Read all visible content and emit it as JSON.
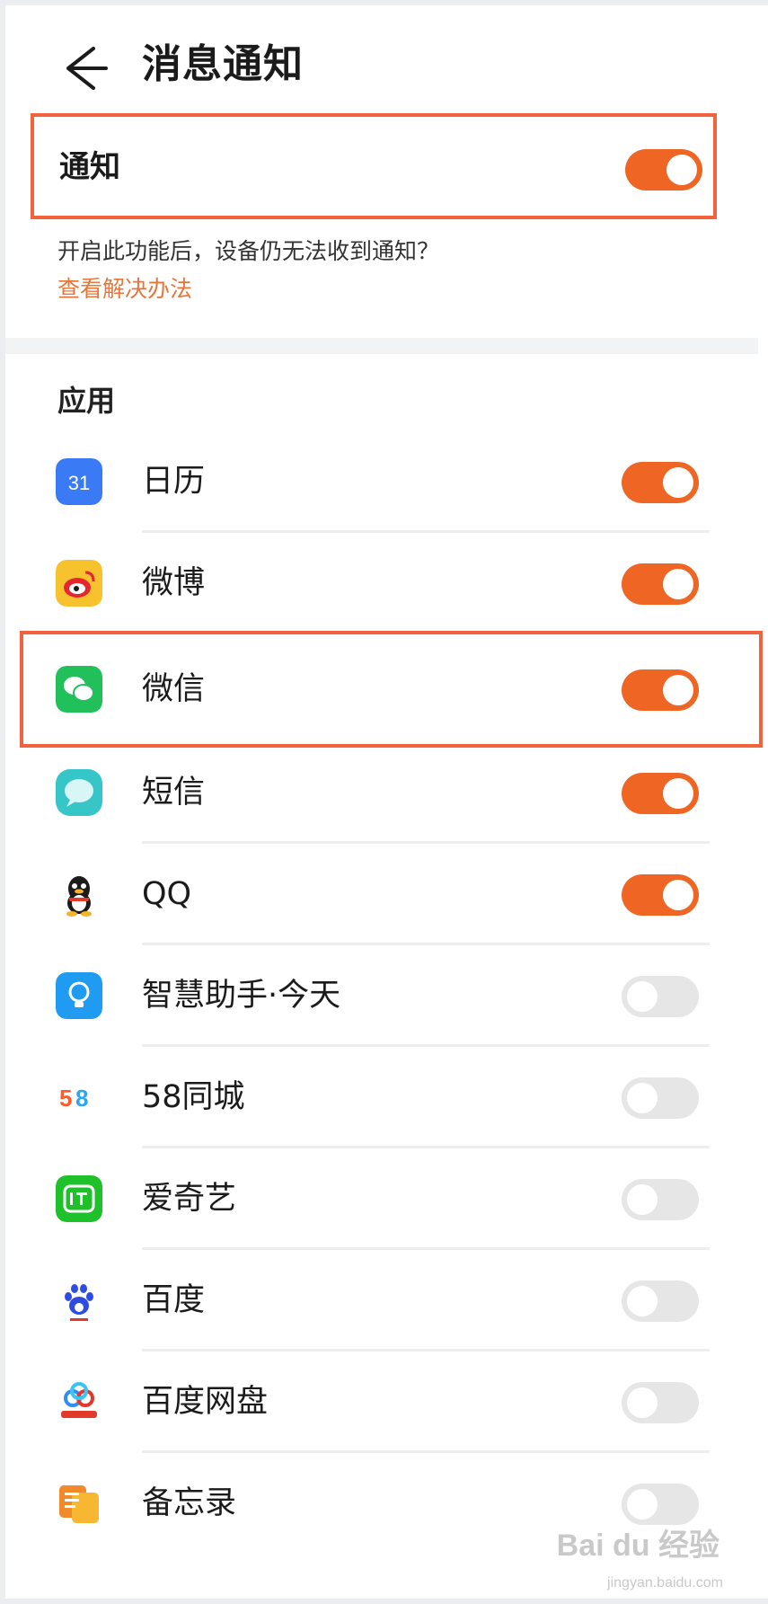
{
  "header": {
    "title": "消息通知",
    "back_icon": "back-arrow-icon"
  },
  "master_notification": {
    "label": "通知",
    "enabled": true
  },
  "hint": {
    "text": "开启此功能后，设备仍无法收到通知？",
    "link": "查看解决办法"
  },
  "section_title": "应用",
  "apps": [
    {
      "name": "日历",
      "icon": "calendar-icon",
      "enabled": true
    },
    {
      "name": "微博",
      "icon": "weibo-icon",
      "enabled": true
    },
    {
      "name": "微信",
      "icon": "wechat-icon",
      "enabled": true
    },
    {
      "name": "短信",
      "icon": "sms-icon",
      "enabled": true
    },
    {
      "name": "QQ",
      "icon": "qq-penguin-icon",
      "enabled": true
    },
    {
      "name": "智慧助手·今天",
      "icon": "smart-assistant-icon",
      "enabled": false
    },
    {
      "name": "58同城",
      "icon": "58-logo-icon",
      "enabled": false
    },
    {
      "name": "爱奇艺",
      "icon": "iqiyi-icon",
      "enabled": false
    },
    {
      "name": "百度",
      "icon": "baidu-paw-icon",
      "enabled": false
    },
    {
      "name": "百度网盘",
      "icon": "baidu-netdisk-icon",
      "enabled": false
    },
    {
      "name": "备忘录",
      "icon": "notes-icon",
      "enabled": false
    }
  ],
  "colors": {
    "accent": "#ee6524",
    "highlight": "#f2623c",
    "link": "#e87539"
  },
  "watermark": {
    "text": "Bai du 经验",
    "sub": "jingyan.baidu.com"
  }
}
